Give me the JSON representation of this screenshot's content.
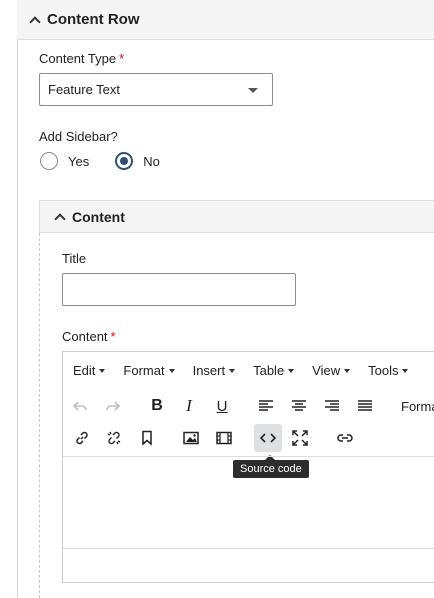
{
  "section": {
    "title": "Content Row"
  },
  "content_type": {
    "label": "Content Type",
    "required_mark": "*",
    "value": "Feature Text"
  },
  "sidebar": {
    "label": "Add Sidebar?",
    "options": [
      "Yes",
      "No"
    ],
    "selected": "No"
  },
  "content_section": {
    "title": "Content",
    "title_field": {
      "label": "Title",
      "value": ""
    },
    "content_field": {
      "label": "Content",
      "required_mark": "*"
    }
  },
  "editor": {
    "menus": [
      "Edit",
      "Format",
      "Insert",
      "Table",
      "View",
      "Tools"
    ],
    "format_label": "Forma",
    "toolbar_icons": [
      "undo-icon",
      "redo-icon",
      "bold-icon",
      "italic-icon",
      "underline-icon",
      "align-left-icon",
      "align-center-icon",
      "align-right-icon",
      "align-justify-icon",
      "link-icon",
      "unlink-icon",
      "bookmark-icon",
      "image-icon",
      "media-icon",
      "source-code-icon",
      "fullscreen-icon",
      "link-chain-icon"
    ],
    "tooltip": "Source code"
  },
  "colors": {
    "accent": "#2f4f73",
    "required": "#d0021b",
    "header_bg": "#f5f5f5",
    "tooltip_bg": "#2d2d2d"
  }
}
